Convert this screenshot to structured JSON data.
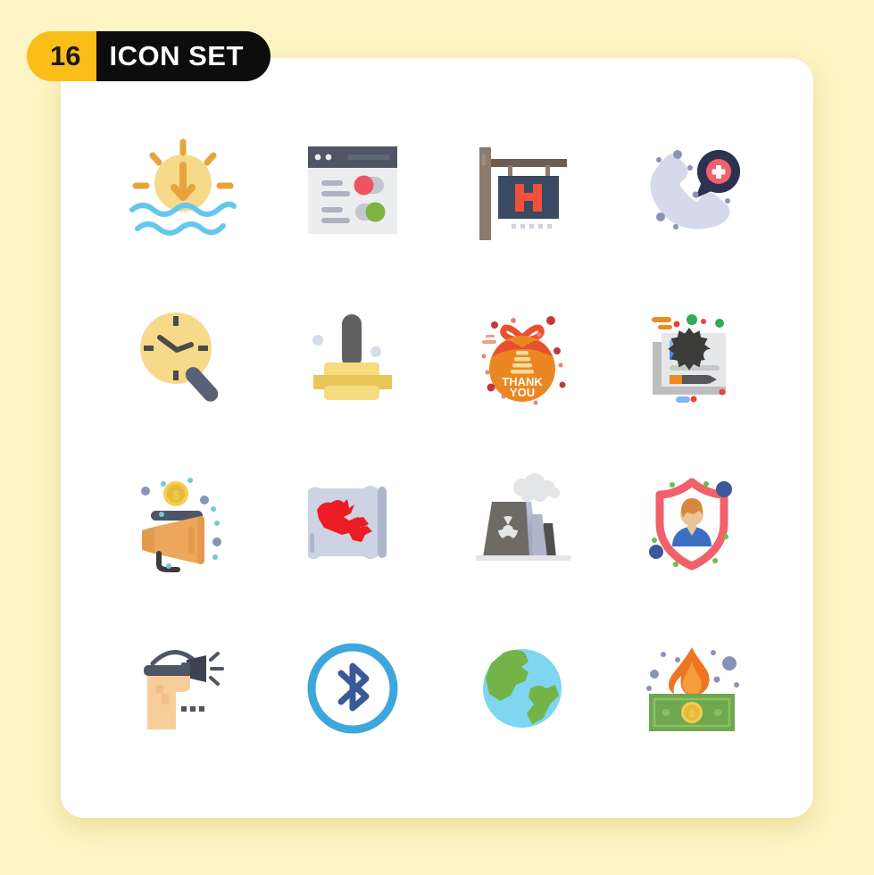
{
  "page": {
    "background_color": "#FCF4C4",
    "card_color": "#FFFFFF"
  },
  "header": {
    "count": "16",
    "title": "ICON SET",
    "count_bg": "#FBBE18",
    "title_bg": "#0D0D0D",
    "count_text_color": "#1A1A1A",
    "title_text_color": "#FFFFFF"
  },
  "grid": {
    "columns": 4,
    "rows": 4,
    "total": 16
  },
  "icons": [
    {
      "index": 1,
      "name": "sunset-icon",
      "label": "Sunset",
      "colors": [
        "#F7D98A",
        "#E8A33D",
        "#64C8EC"
      ]
    },
    {
      "index": 2,
      "name": "browser-settings-icon",
      "label": "Browser Settings",
      "colors": [
        "#4F5565",
        "#ECEDEF",
        "#ED5565",
        "#7CB342"
      ]
    },
    {
      "index": 3,
      "name": "hotel-sign-icon",
      "label": "Hotel Sign",
      "colors": [
        "#8D7B6E",
        "#3B4A63",
        "#F0503C"
      ]
    },
    {
      "index": 4,
      "name": "emergency-call-icon",
      "label": "Emergency Call",
      "colors": [
        "#D5D9EA",
        "#2D3253",
        "#F2606B"
      ]
    },
    {
      "index": 5,
      "name": "clock-search-icon",
      "label": "Time Search",
      "colors": [
        "#F7D98A",
        "#4A4A4A",
        "#5A6175"
      ]
    },
    {
      "index": 6,
      "name": "stamp-icon",
      "label": "Stamp",
      "colors": [
        "#616161",
        "#F7DC7E",
        "#E8C659"
      ]
    },
    {
      "index": 7,
      "name": "thank-you-gift-icon",
      "label": "Thank You Gift",
      "colors": [
        "#E8512F",
        "#EB8722",
        "#FFFFFF"
      ],
      "text": "THANK YOU"
    },
    {
      "index": 8,
      "name": "web-development-icon",
      "label": "Web Development",
      "colors": [
        "#E6E7E8",
        "#4285F4",
        "#EE8A22",
        "#3C3C3B"
      ]
    },
    {
      "index": 9,
      "name": "crowdfunding-icon",
      "label": "Crowdfunding",
      "colors": [
        "#EDA75C",
        "#F4CE4E",
        "#4F5565"
      ]
    },
    {
      "index": 10,
      "name": "canada-map-icon",
      "label": "Canada Map",
      "colors": [
        "#CDD3E2",
        "#EC1C24"
      ]
    },
    {
      "index": 11,
      "name": "nuclear-plant-icon",
      "label": "Nuclear Plant",
      "colors": [
        "#6E6A66",
        "#50504F",
        "#AEB6CC",
        "#E4E5E7"
      ]
    },
    {
      "index": 12,
      "name": "user-protection-icon",
      "label": "User Protection",
      "colors": [
        "#F2606B",
        "#3B6FC4",
        "#E8A87C",
        "#6ABF4B"
      ]
    },
    {
      "index": 13,
      "name": "flashlight-hand-icon",
      "label": "Flashlight",
      "colors": [
        "#4F5565",
        "#F7CE9A"
      ]
    },
    {
      "index": 14,
      "name": "bluetooth-icon",
      "label": "Bluetooth",
      "colors": [
        "#3EA6DC",
        "#3B5998"
      ]
    },
    {
      "index": 15,
      "name": "globe-icon",
      "label": "Globe",
      "colors": [
        "#7FD6F0",
        "#74B348"
      ]
    },
    {
      "index": 16,
      "name": "burning-money-icon",
      "label": "Burning Money",
      "colors": [
        "#6FA84F",
        "#EE7622",
        "#F4CE4E"
      ]
    }
  ]
}
